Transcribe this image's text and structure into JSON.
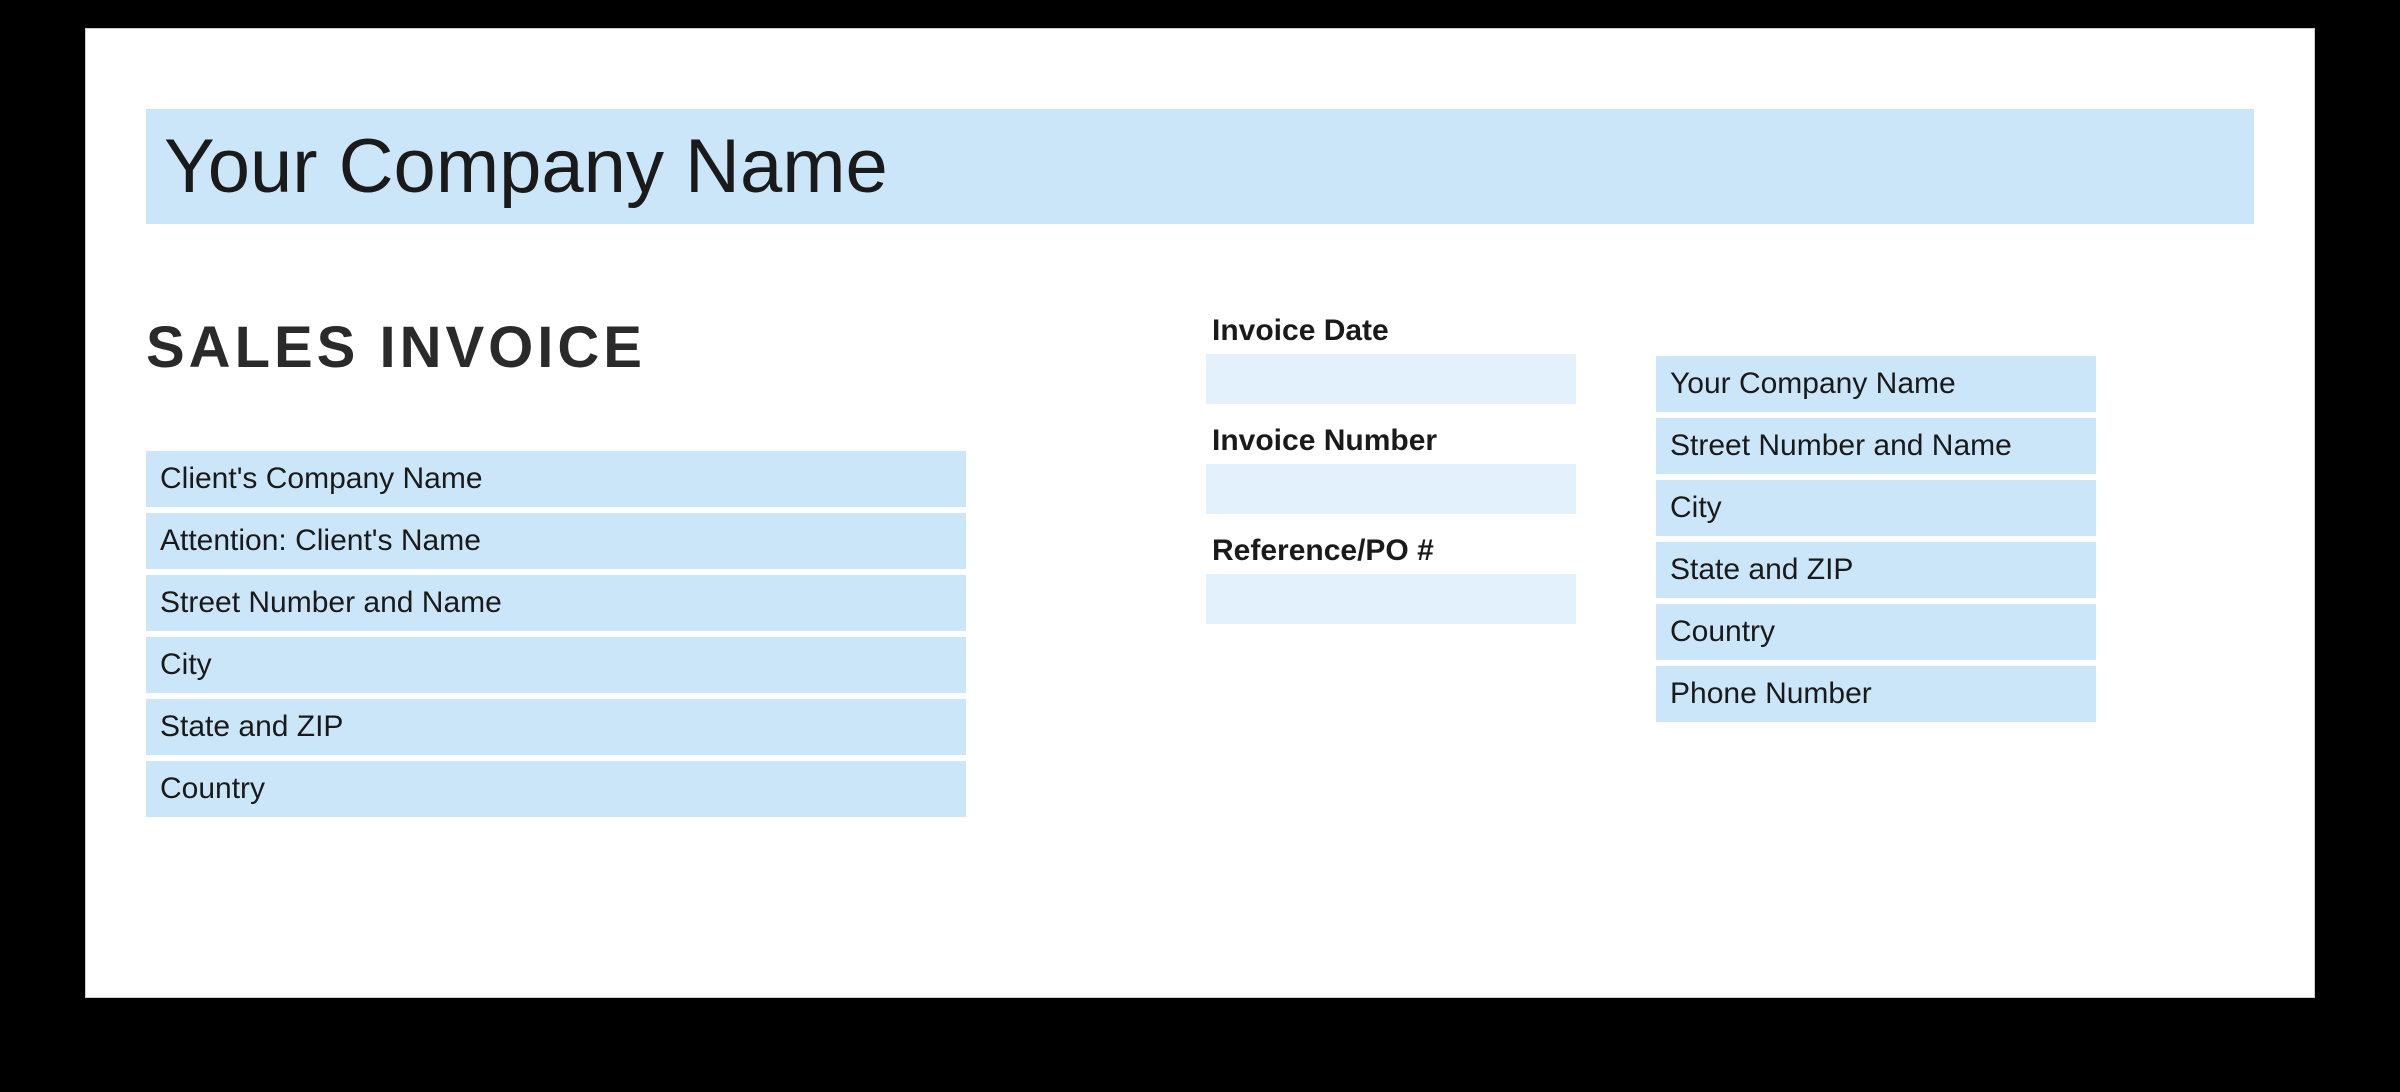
{
  "header": {
    "company_name": "Your Company Name"
  },
  "title": "SALES INVOICE",
  "client": {
    "company": "Client's Company Name",
    "attention": "Attention: Client's Name",
    "street": "Street Number and Name",
    "city": "City",
    "state_zip": "State and ZIP",
    "country": "Country"
  },
  "meta": {
    "invoice_date_label": "Invoice Date",
    "invoice_date_value": "",
    "invoice_number_label": "Invoice Number",
    "invoice_number_value": "",
    "reference_label": "Reference/PO #",
    "reference_value": ""
  },
  "sender": {
    "company": "Your Company Name",
    "street": "Street Number and Name",
    "city": "City",
    "state_zip": "State and ZIP",
    "country": "Country",
    "phone": "Phone Number"
  }
}
